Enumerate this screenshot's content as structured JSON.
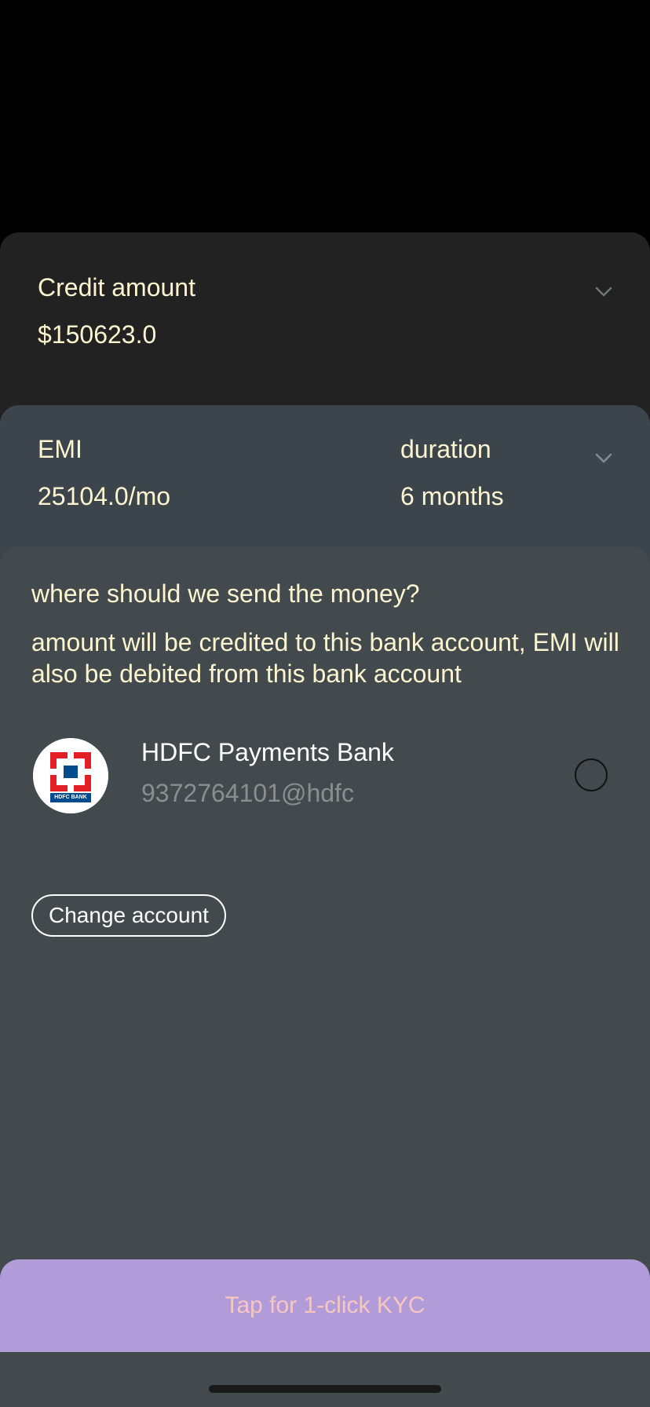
{
  "credit": {
    "label": "Credit amount",
    "value": "$150623.0",
    "chevron_icon": "chevron-down-icon"
  },
  "emi": {
    "label": "EMI",
    "value": "25104.0/mo",
    "duration_label": "duration",
    "duration_value": "6 months",
    "chevron_icon": "chevron-down-icon"
  },
  "payout": {
    "question": "where should we send the money?",
    "info": "amount will be credited to this bank account, EMI will also be debited from this bank account",
    "bank": {
      "name": "HDFC Payments Bank",
      "upi": "9372764101@hdfc",
      "logo_text": "HDFC BANK",
      "selected": false
    },
    "change_account_label": "Change account"
  },
  "cta": {
    "label": "Tap for 1-click KYC"
  },
  "colors": {
    "text_cream": "#fdf5d0",
    "credit_card_bg": "#222222",
    "emi_card_bg": "#3c454c",
    "main_card_bg": "#424a4e",
    "cta_bg": "#b19cd9",
    "cta_text": "#f7c6c1",
    "hdfc_red": "#e31e24",
    "hdfc_blue": "#004c8f"
  }
}
